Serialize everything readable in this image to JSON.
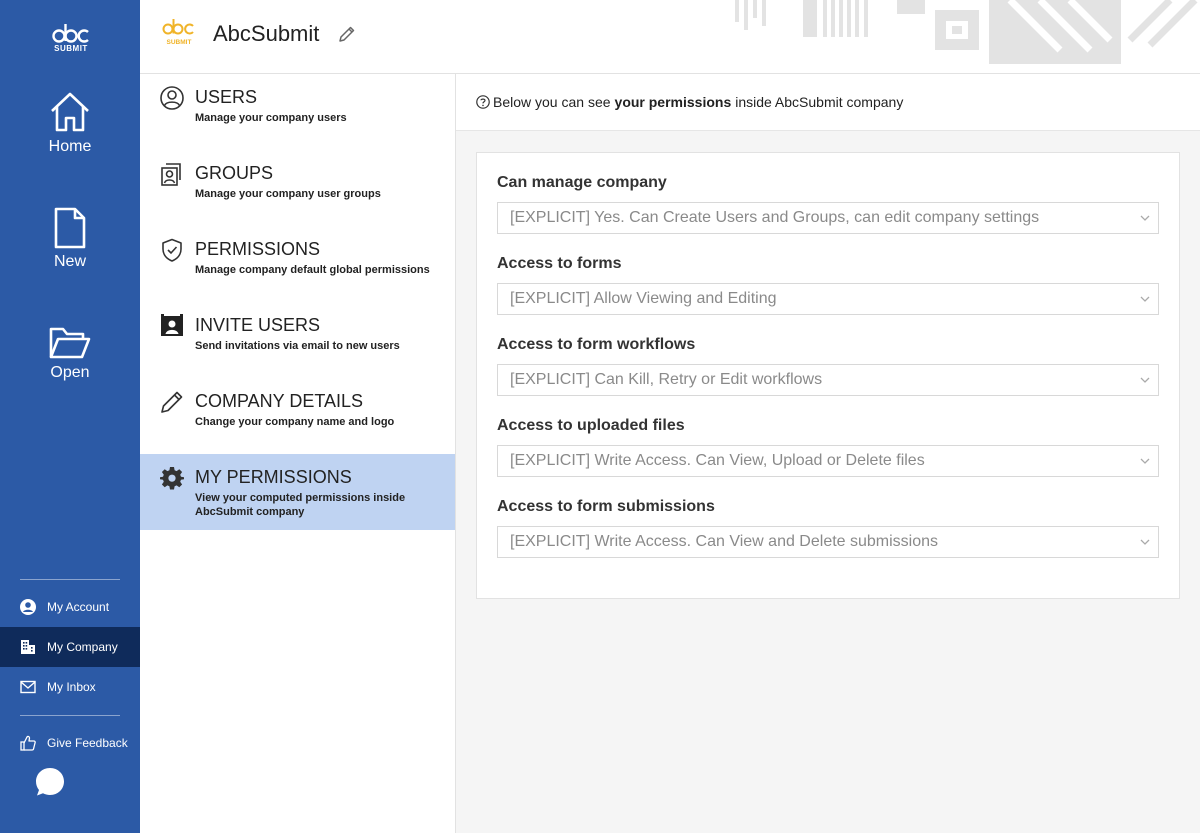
{
  "rail": {
    "logo_text": "SUBMIT",
    "items": [
      {
        "label": "Home",
        "icon": "home-icon"
      },
      {
        "label": "New",
        "icon": "file-icon"
      },
      {
        "label": "Open",
        "icon": "folder-open-icon"
      }
    ],
    "links": [
      {
        "label": "My Account",
        "icon": "user-circle-icon",
        "active": false
      },
      {
        "label": "My Company",
        "icon": "building-icon",
        "active": true
      },
      {
        "label": "My Inbox",
        "icon": "envelope-icon",
        "active": false
      },
      {
        "label": "Give Feedback",
        "icon": "thumbs-up-icon",
        "active": false
      }
    ],
    "colors": {
      "rail": "#2c5aa6",
      "active": "#0f2b5b",
      "accent": "#f0b429"
    }
  },
  "header": {
    "company_name": "AbcSubmit",
    "logo_text": "SUBMIT"
  },
  "settings_nav": {
    "items": [
      {
        "title": "USERS",
        "desc": "Manage your company users",
        "icon": "user-circle-icon"
      },
      {
        "title": "GROUPS",
        "desc": "Manage your company user groups",
        "icon": "group-icon"
      },
      {
        "title": "PERMISSIONS",
        "desc": "Manage company default global permissions",
        "icon": "shield-check-icon"
      },
      {
        "title": "INVITE USERS",
        "desc": "Send invitations via email to new users",
        "icon": "contact-card-icon"
      },
      {
        "title": "COMPANY DETAILS",
        "desc": "Change your company name and logo",
        "icon": "pencil-icon"
      },
      {
        "title": "MY PERMISSIONS",
        "desc": "View your computed permissions inside AbcSubmit company",
        "icon": "gear-icon"
      }
    ],
    "active_color": "#bfd3f2"
  },
  "info": {
    "prefix": "Below you can see",
    "bold": "your permissions",
    "suffix": "inside AbcSubmit company"
  },
  "permissions": [
    {
      "label": "Can manage company",
      "value": "[EXPLICIT] Yes. Can Create Users and Groups, can edit company settings"
    },
    {
      "label": "Access to forms",
      "value": "[EXPLICIT] Allow Viewing and Editing"
    },
    {
      "label": "Access to form workflows",
      "value": "[EXPLICIT] Can Kill, Retry or Edit workflows"
    },
    {
      "label": "Access to uploaded files",
      "value": "[EXPLICIT] Write Access. Can View, Upload or Delete files"
    },
    {
      "label": "Access to form submissions",
      "value": "[EXPLICIT] Write Access. Can View and Delete submissions"
    }
  ]
}
